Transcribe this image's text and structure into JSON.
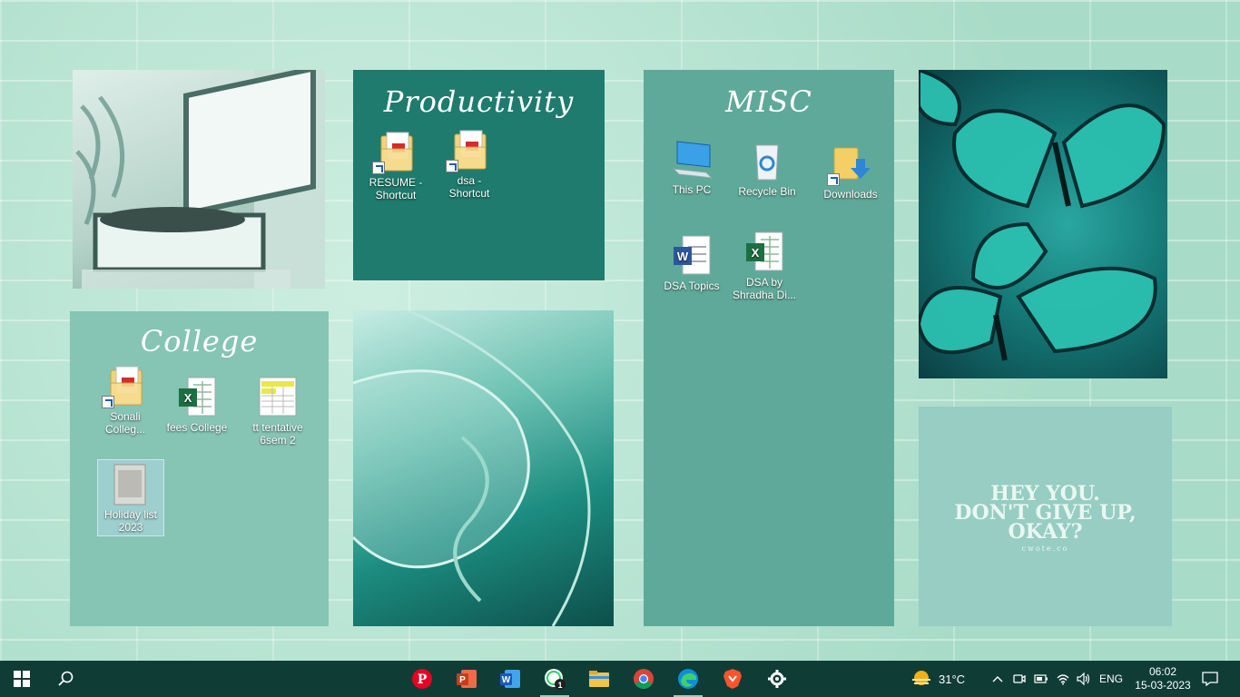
{
  "panels": {
    "productivity": {
      "title": "Productivity",
      "color": "#1e7b6e"
    },
    "misc": {
      "title": "MISC",
      "color": "#5fa99a"
    },
    "college": {
      "title": "College",
      "color": "#86c4b4"
    },
    "quote": {
      "color": "#97cdc3",
      "line1": "HEY YOU.",
      "line2": "DON'T GIVE UP,",
      "line3": "OKAY?",
      "credit": "cwote.co"
    }
  },
  "icons": {
    "resume": {
      "label": "RESUME - Shortcut",
      "icon": "pdf-folder-shortcut-icon"
    },
    "dsa": {
      "label": "dsa - Shortcut",
      "icon": "pdf-folder-shortcut-icon"
    },
    "this_pc": {
      "label": "This PC",
      "icon": "computer-icon"
    },
    "recycle_bin": {
      "label": "Recycle Bin",
      "icon": "recycle-bin-icon"
    },
    "downloads": {
      "label": "Downloads",
      "icon": "downloads-folder-icon"
    },
    "dsa_topics": {
      "label": "DSA Topics",
      "icon": "word-document-icon"
    },
    "dsa_shradha": {
      "label": "DSA by Shradha Di...",
      "icon": "excel-document-icon"
    },
    "sonali_college": {
      "label": "Sonali Colleg...",
      "icon": "pdf-folder-shortcut-icon"
    },
    "fees_college": {
      "label": "fees College",
      "icon": "excel-document-icon"
    },
    "tt_tentative": {
      "label": "tt tentative 6sem 2",
      "icon": "spreadsheet-thumbnail-icon"
    },
    "holiday_list": {
      "label": "Holiday list 2023",
      "icon": "image-thumbnail-icon"
    }
  },
  "taskbar": {
    "apps": [
      "pinterest",
      "powerpoint",
      "word",
      "whatsapp",
      "file-explorer",
      "chrome",
      "edge",
      "brave",
      "settings"
    ],
    "whatsapp_badge": "1",
    "weather": "31°C",
    "language": "ENG",
    "time": "06:02",
    "date": "15-03-2023"
  }
}
